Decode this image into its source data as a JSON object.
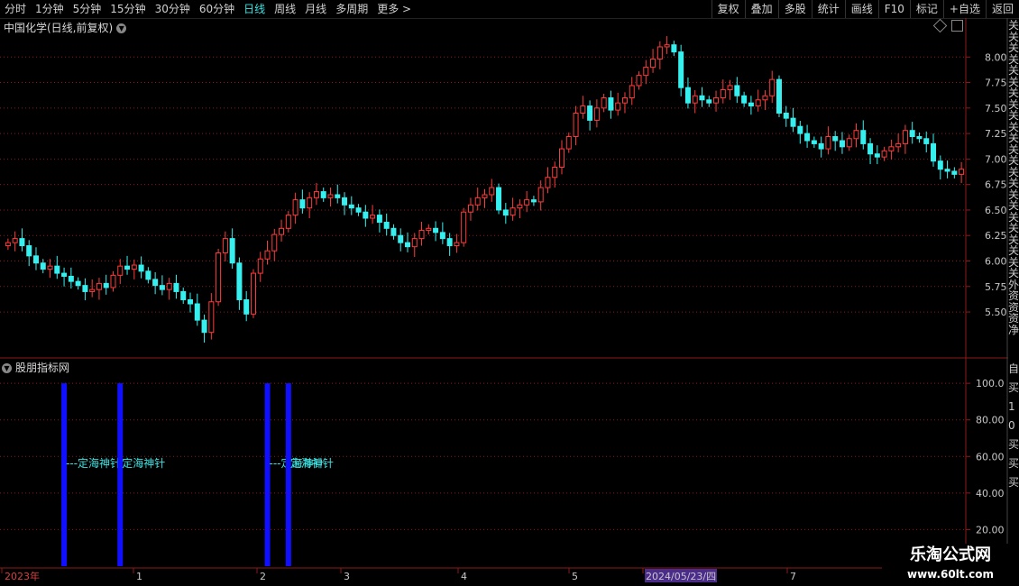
{
  "toolbar": {
    "tabs": [
      "分时",
      "1分钟",
      "5分钟",
      "15分钟",
      "30分钟",
      "60分钟",
      "日线",
      "周线",
      "月线",
      "多周期",
      "更多 >"
    ],
    "active": 6,
    "right": [
      "复权",
      "叠加",
      "多股",
      "统计",
      "画线",
      "F10",
      "标记",
      "+自选",
      "返回"
    ]
  },
  "chart_title": "中国化学(日线,前复权)",
  "indicator_title": "股朋指标网",
  "logo": {
    "line1": "乐淘公式网",
    "line2": "www.60lt.com"
  },
  "right_edge_text": "关关关关关关关关关关关关关关关关关关关关关关关外资资资净",
  "right_edge_text2": "自买10买买买",
  "colors": {
    "up": "#ff3b3b",
    "down": "#36f0f0",
    "bar": "#1010ff",
    "grid": "#8b1a1a",
    "label": "#3ee1e1"
  },
  "chart_data": {
    "type": "candlestick",
    "price_axis": {
      "ticks": [
        "8.00",
        "7.75",
        "7.50",
        "7.25",
        "7.00",
        "6.75",
        "6.50",
        "6.25",
        "6.00",
        "5.75",
        "5.50"
      ],
      "range": [
        5.2,
        8.25
      ]
    },
    "indicator_axis": {
      "ticks": [
        "100.0",
        "80.00",
        "60.00",
        "40.00",
        "20.00"
      ],
      "range": [
        0,
        105
      ]
    },
    "x_labels": [
      "2023年",
      "1",
      "2",
      "3",
      "4",
      "5",
      "2024/05/23/四",
      "7"
    ],
    "signals": [
      {
        "index": 8,
        "value": 100,
        "label": "---定海神针"
      },
      {
        "index": 16,
        "value": 100,
        "label": "定海神针"
      },
      {
        "index": 37,
        "value": 100,
        "label": "---定海神针"
      },
      {
        "index": 40,
        "value": 100,
        "label": "定海神针"
      }
    ],
    "closes": [
      6.18,
      6.22,
      6.15,
      6.05,
      5.98,
      5.92,
      5.95,
      5.88,
      5.85,
      5.8,
      5.76,
      5.7,
      5.72,
      5.78,
      5.74,
      5.86,
      5.95,
      5.92,
      5.96,
      5.9,
      5.82,
      5.76,
      5.72,
      5.78,
      5.7,
      5.62,
      5.58,
      5.42,
      5.3,
      5.6,
      6.08,
      6.22,
      5.98,
      5.62,
      5.48,
      5.88,
      6.02,
      6.1,
      6.26,
      6.32,
      6.45,
      6.6,
      6.52,
      6.62,
      6.68,
      6.62,
      6.65,
      6.62,
      6.55,
      6.52,
      6.48,
      6.42,
      6.45,
      6.38,
      6.32,
      6.25,
      6.18,
      6.14,
      6.22,
      6.3,
      6.32,
      6.28,
      6.22,
      6.15,
      6.18,
      6.48,
      6.55,
      6.62,
      6.65,
      6.72,
      6.5,
      6.45,
      6.52,
      6.55,
      6.6,
      6.58,
      6.72,
      6.82,
      6.92,
      7.1,
      7.22,
      7.45,
      7.52,
      7.38,
      7.5,
      7.6,
      7.48,
      7.55,
      7.6,
      7.72,
      7.82,
      7.9,
      7.98,
      8.1,
      8.12,
      8.05,
      7.7,
      7.55,
      7.62,
      7.58,
      7.55,
      7.6,
      7.68,
      7.72,
      7.62,
      7.55,
      7.52,
      7.58,
      7.62,
      7.78,
      7.45,
      7.4,
      7.32,
      7.25,
      7.18,
      7.15,
      7.1,
      7.22,
      7.18,
      7.12,
      7.2,
      7.28,
      7.15,
      7.05,
      7.02,
      7.08,
      7.12,
      7.15,
      7.28,
      7.22,
      7.2,
      7.15,
      6.98,
      6.9,
      6.88,
      6.85,
      6.9
    ]
  }
}
